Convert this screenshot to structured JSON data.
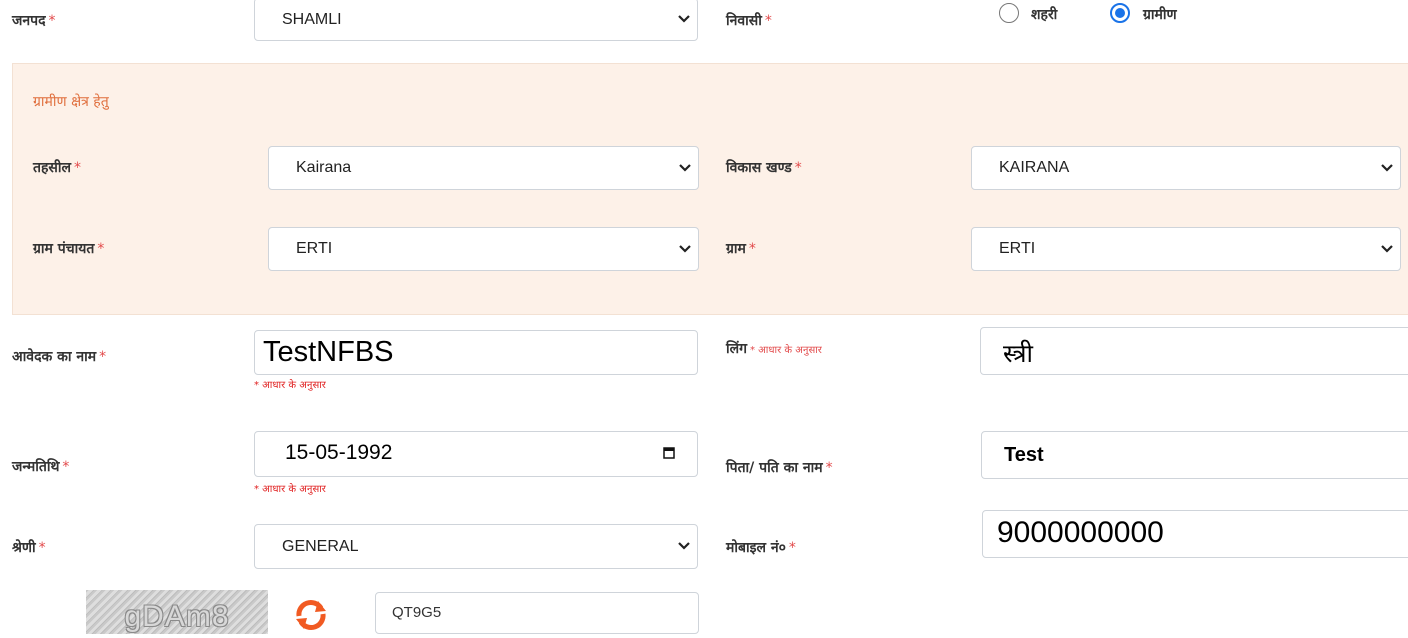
{
  "required_mark": "*",
  "district": {
    "label": "जनपद",
    "value": "SHAMLI"
  },
  "residence": {
    "label": "निवासी",
    "options": [
      {
        "label": "शहरी",
        "checked": false
      },
      {
        "label": "ग्रामीण",
        "checked": true
      }
    ]
  },
  "rural_section": {
    "title": "ग्रामीण क्षेत्र हेतु",
    "tehsil": {
      "label": "तहसील",
      "value": "Kairana"
    },
    "block": {
      "label": "विकास खण्ड",
      "value": "KAIRANA"
    },
    "gram_panchayat": {
      "label": "ग्राम पंचायत",
      "value": "ERTI"
    },
    "village": {
      "label": "ग्राम",
      "value": "ERTI"
    }
  },
  "applicant_name": {
    "label": "आवेदक का नाम",
    "value": "TestNFBS",
    "hint": "* आधार के अनुसार"
  },
  "gender": {
    "label": "लिंग",
    "note": "* आधार के अनुसार",
    "value": "स्त्री"
  },
  "dob": {
    "label": "जन्मतिथि",
    "value": "15-05-1992",
    "hint": "* आधार के अनुसार"
  },
  "father_husband_name": {
    "label": "पिता/ पति का नाम",
    "value": "Test"
  },
  "category": {
    "label": "श्रेणी",
    "value": "GENERAL"
  },
  "mobile": {
    "label": "मोबाइल नं०",
    "value": "9000000000"
  },
  "captcha": {
    "image_text": "gDAm8",
    "input_value": "QT9G5",
    "refresh_icon": "refresh-icon"
  },
  "colors": {
    "accent": "#1a73e8",
    "required": "#e2494a",
    "panel_bg": "#fdf1e8",
    "panel_title": "#e06e3c",
    "refresh": "#f15a22"
  }
}
